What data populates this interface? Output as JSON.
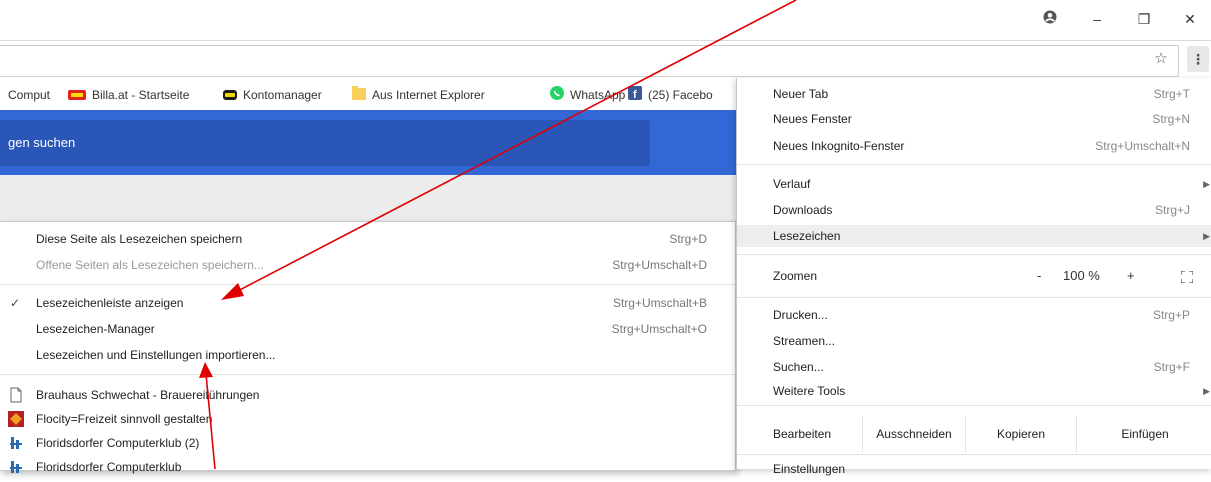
{
  "window": {
    "account_icon": "account-circle-icon",
    "minimize": "–",
    "restore": "❐",
    "close": "✕"
  },
  "toolbar": {
    "star": "☆",
    "menu": "⋮"
  },
  "bookmarks_bar": [
    {
      "label": "Comput",
      "icon": "none"
    },
    {
      "label": "Billa.at - Startseite",
      "icon": "billa-icon"
    },
    {
      "label": "Kontomanager",
      "icon": "kontomanager-icon"
    },
    {
      "label": "Aus Internet Explorer",
      "icon": "folder-icon"
    },
    {
      "label": "WhatsApp",
      "icon": "whatsapp-icon"
    },
    {
      "label": "(25) Facebo",
      "icon": "facebook-icon"
    }
  ],
  "page": {
    "search_text": "gen suchen"
  },
  "bookmarks_submenu": {
    "items": [
      {
        "label": "Diese Seite als Lesezeichen speichern",
        "shortcut": "Strg+D"
      },
      {
        "label": "Offene Seiten als Lesezeichen speichern...",
        "shortcut": "Strg+Umschalt+D"
      },
      {
        "label": "Lesezeichenleiste anzeigen",
        "shortcut": "Strg+Umschalt+B",
        "check": "✓"
      },
      {
        "label": "Lesezeichen-Manager",
        "shortcut": "Strg+Umschalt+O"
      },
      {
        "label": "Lesezeichen und Einstellungen importieren...",
        "shortcut": ""
      },
      {
        "label": "Brauhaus Schwechat - Brauereiführungen"
      },
      {
        "label": "Flocity=Freizeit sinnvoll gestalten"
      },
      {
        "label": "Floridsdorfer Computerklub (2)"
      },
      {
        "label": "Floridsdorfer Computerklub"
      }
    ]
  },
  "main_menu": {
    "new_tab": {
      "label": "Neuer Tab",
      "shortcut": "Strg+T"
    },
    "new_window": {
      "label": "Neues Fenster",
      "shortcut": "Strg+N"
    },
    "incognito": {
      "label": "Neues Inkognito-Fenster",
      "shortcut": "Strg+Umschalt+N"
    },
    "history": {
      "label": "Verlauf"
    },
    "downloads": {
      "label": "Downloads",
      "shortcut": "Strg+J"
    },
    "bookmarks": {
      "label": "Lesezeichen"
    },
    "zoom": {
      "label": "Zoomen",
      "minus": "-",
      "level": "100 %",
      "plus": "+",
      "fullscreen": "fullscreen-icon"
    },
    "print": {
      "label": "Drucken...",
      "shortcut": "Strg+P"
    },
    "cast": {
      "label": "Streamen..."
    },
    "find": {
      "label": "Suchen...",
      "shortcut": "Strg+F"
    },
    "more_tools": {
      "label": "Weitere Tools"
    },
    "edit": {
      "label": "Bearbeiten",
      "cut": "Ausschneiden",
      "copy": "Kopieren",
      "paste": "Einfügen"
    },
    "settings": {
      "label": "Einstellungen"
    }
  },
  "colors": {
    "annotation_arrow": "#e00000",
    "page_blue": "#3367d6"
  }
}
